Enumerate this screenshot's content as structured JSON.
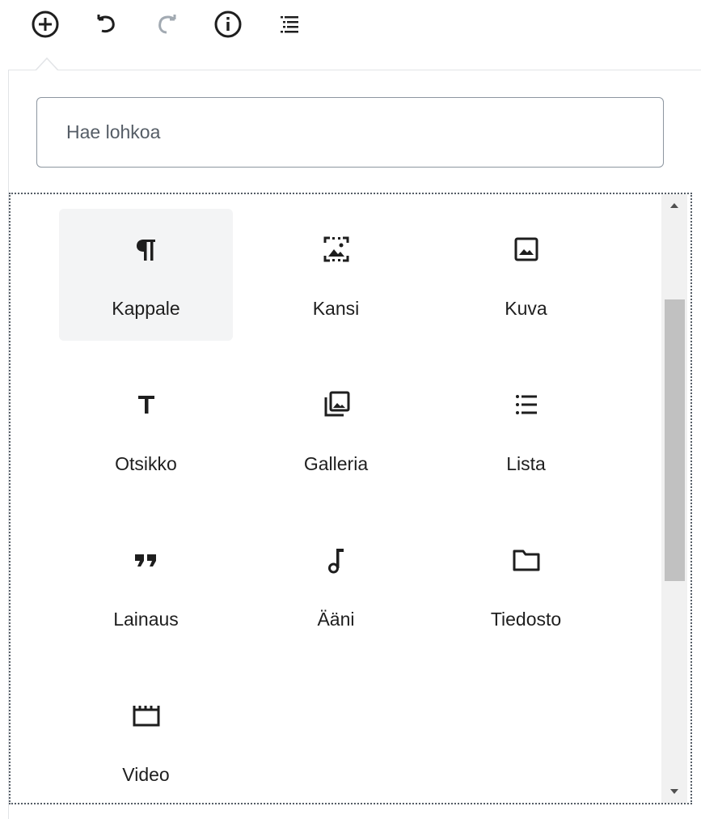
{
  "toolbar": {
    "buttons": [
      {
        "name": "add-block",
        "icon": "plus-circle-icon"
      },
      {
        "name": "undo",
        "icon": "undo-icon"
      },
      {
        "name": "redo",
        "icon": "redo-icon"
      },
      {
        "name": "info",
        "icon": "info-icon"
      },
      {
        "name": "outline",
        "icon": "list-outline-icon"
      }
    ]
  },
  "search": {
    "placeholder": "Hae lohkoa",
    "value": ""
  },
  "blocks": [
    {
      "label": "Kappale",
      "icon": "paragraph-icon",
      "active": true
    },
    {
      "label": "Kansi",
      "icon": "cover-image-icon"
    },
    {
      "label": "Kuva",
      "icon": "image-icon"
    },
    {
      "label": "Otsikko",
      "icon": "heading-icon"
    },
    {
      "label": "Galleria",
      "icon": "gallery-icon"
    },
    {
      "label": "Lista",
      "icon": "list-icon"
    },
    {
      "label": "Lainaus",
      "icon": "quote-icon"
    },
    {
      "label": "Ääni",
      "icon": "audio-note-icon"
    },
    {
      "label": "Tiedosto",
      "icon": "folder-icon"
    },
    {
      "label": "Video",
      "icon": "video-icon"
    }
  ],
  "colors": {
    "icon": "#1e1e1e",
    "disabled_icon": "#a2aab2",
    "active_bg": "#f3f4f5",
    "scroll_thumb": "#c1c1c1"
  }
}
